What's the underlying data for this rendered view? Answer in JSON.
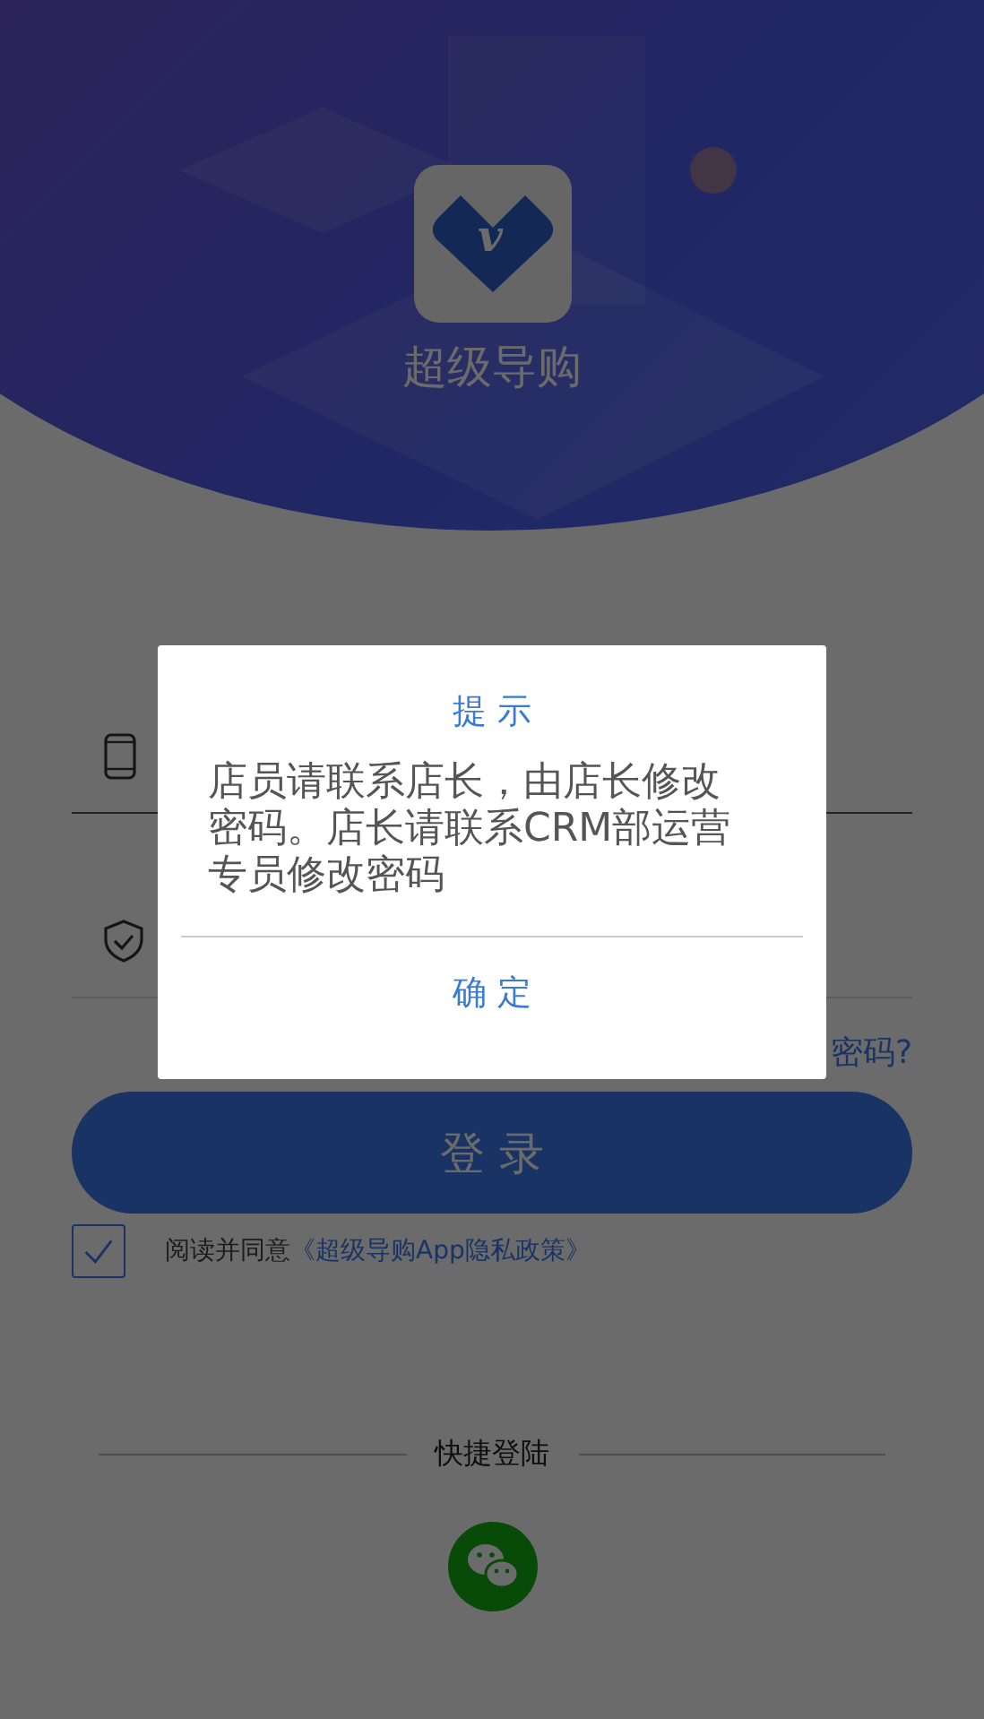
{
  "app": {
    "logo_letter": "v",
    "name": "超级导购"
  },
  "login": {
    "forgot_link": "密码?",
    "button": "登 录"
  },
  "agreement": {
    "checked": true,
    "text": "阅读并同意",
    "link": "《超级导购App隐私政策》"
  },
  "quick_login": {
    "label": "快捷登陆"
  },
  "dialog": {
    "title": "提 示",
    "message": "店员请联系店长，由店长修改密码。店长请联系CRM部运营专员修改密码",
    "confirm": "确 定"
  }
}
